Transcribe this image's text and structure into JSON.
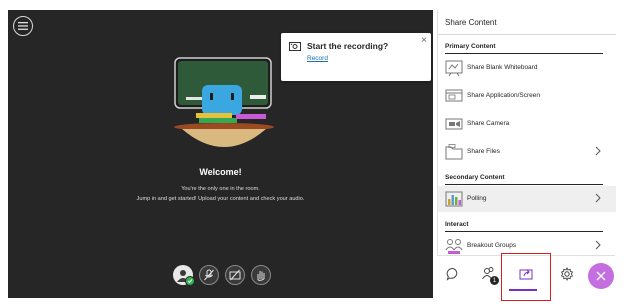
{
  "stage": {
    "menu_icon": "hamburger-menu-icon",
    "recording": {
      "title": "Start the recording?",
      "link": "Record",
      "close": "×"
    },
    "welcome": "Welcome!",
    "subtitle_1": "You're the only one in the room.",
    "subtitle_2": "Jump in and get started! Upload your content and check your audio.",
    "controls": [
      "avatar",
      "microphone-muted-icon",
      "camera-off-icon",
      "raise-hand-icon"
    ]
  },
  "panel": {
    "title": "Share Content",
    "sections": {
      "primary": "Primary Content",
      "secondary": "Secondary Content",
      "interact": "Interact"
    },
    "items": {
      "whiteboard": "Share Blank Whiteboard",
      "app_screen": "Share Application/Screen",
      "camera": "Share Camera",
      "files": "Share Files",
      "polling": "Polling",
      "breakout": "Breakout Groups"
    }
  },
  "tabs": {
    "items": [
      "chat-icon",
      "attendees-icon",
      "share-content-icon",
      "settings-icon"
    ],
    "attendee_badge": "1",
    "active": "share-content-icon",
    "close_icon": "close-icon"
  },
  "colors": {
    "stage_bg": "#262626",
    "accent": "#7b2fbf",
    "close_button": "#c46ee0",
    "link": "#1a6fb5",
    "highlight": "#d0201f"
  }
}
